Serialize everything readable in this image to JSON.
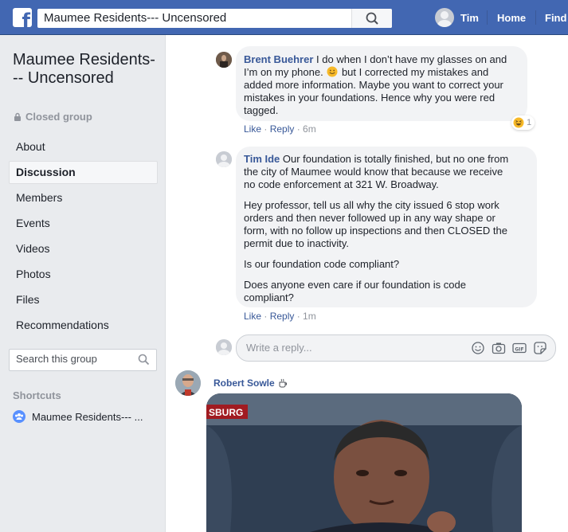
{
  "topbar": {
    "logo": "f",
    "search_value": "Maumee Residents--- Uncensored",
    "user_name": "Tim",
    "nav_home": "Home",
    "nav_find": "Find",
    "brand_color": "#4267b2"
  },
  "sidebar": {
    "group_title": "Maumee Residents--- Uncensored",
    "group_type": "Closed group",
    "menu": [
      {
        "label": "About"
      },
      {
        "label": "Discussion"
      },
      {
        "label": "Members"
      },
      {
        "label": "Events"
      },
      {
        "label": "Videos"
      },
      {
        "label": "Photos"
      },
      {
        "label": "Files"
      },
      {
        "label": "Recommendations"
      }
    ],
    "active_item": "Discussion",
    "search_placeholder": "Search this group",
    "shortcuts_title": "Shortcuts",
    "shortcut_label": "Maumee Residents--- ..."
  },
  "comments": [
    {
      "author": "Brent Buehrer",
      "lines": [
        " I do when I don’t have my glasses on and",
        "I’m on my phone.",
        " but I corrected my mistakes and",
        "added more information. Maybe you want to correct your",
        "mistakes in your foundations. Hence why you were red",
        "tagged."
      ],
      "like": "Like",
      "reply": "Reply",
      "time": "6m",
      "reaction_count": "1"
    },
    {
      "author": "Tim Ide",
      "p1": [
        " Our foundation is totally finished, but no one from",
        "the city of Maumee would know that because we receive",
        "no code enforcement at 321 W. Broadway."
      ],
      "p2": [
        "Hey professor, tell us all why the city issued 6 stop work",
        "orders and then never followed up in any way shape or",
        "form, with no follow up inspections and then CLOSED the",
        "permit due to inactivity."
      ],
      "p3": "Is our foundation code compliant?",
      "p4": [
        "Does anyone even care if our foundation is code",
        "compliant?"
      ],
      "like": "Like",
      "reply": "Reply",
      "time": "1m"
    }
  ],
  "reply_box": {
    "placeholder": "Write a reply..."
  },
  "post": {
    "author": "Robert Sowle",
    "gif_caption": "SBURG"
  }
}
